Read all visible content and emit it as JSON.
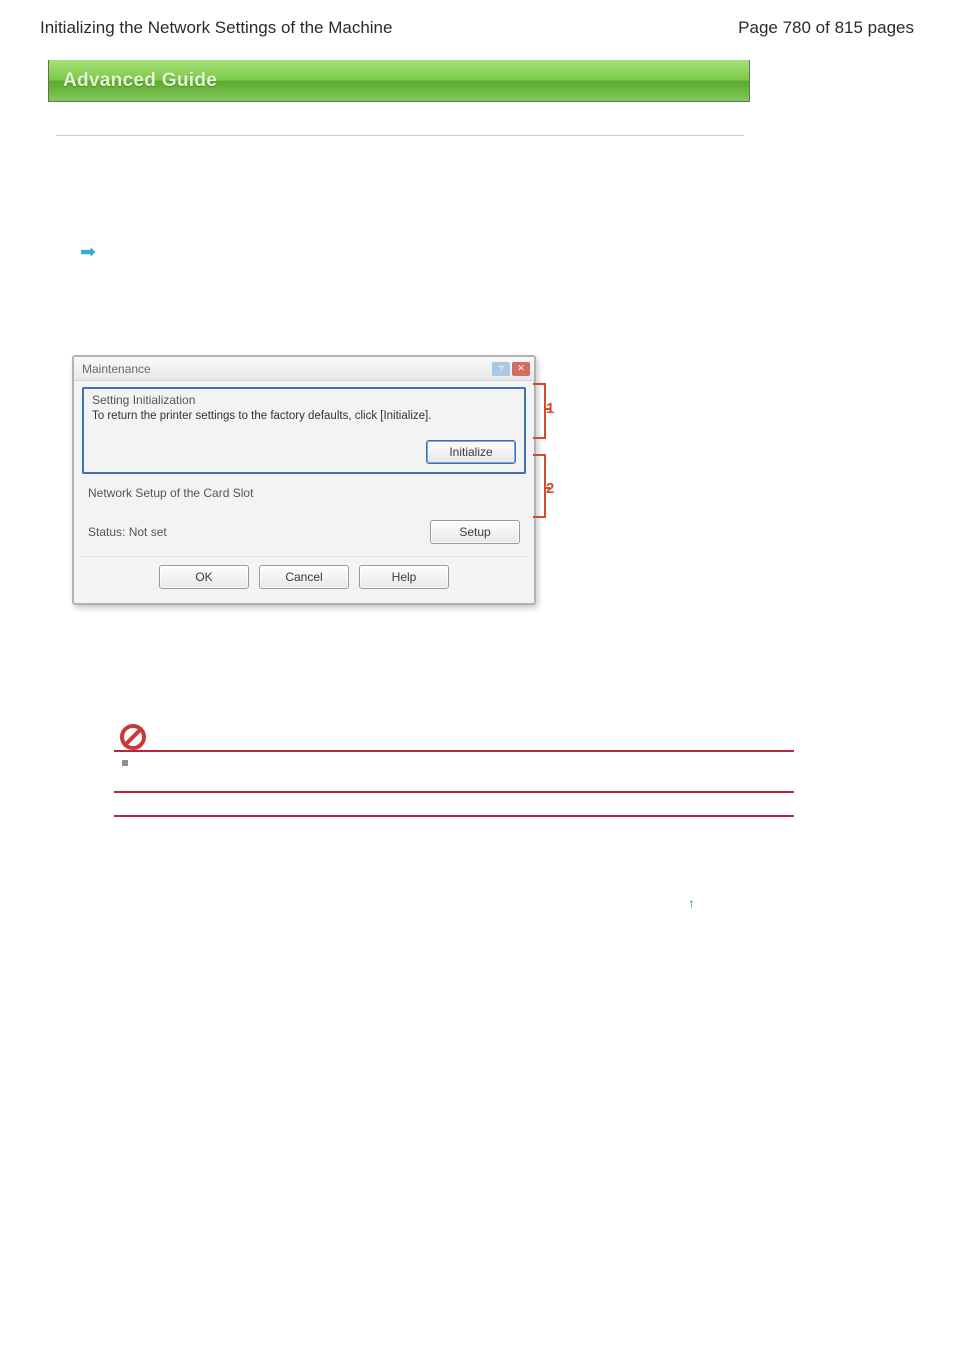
{
  "header": {
    "title": "Initializing the Network Settings of the Machine",
    "page_label": "Page 780 of 815 pages"
  },
  "banner": {
    "text": "Advanced Guide"
  },
  "dialog": {
    "title": "Maintenance",
    "group1_label": "Setting Initialization",
    "group1_desc": "To return the printer settings to the factory defaults, click [Initialize].",
    "initialize_btn": "Initialize",
    "group2_label": "Network Setup of the Card Slot",
    "status_text": "Status: Not set",
    "setup_btn": "Setup",
    "ok_btn": "OK",
    "cancel_btn": "Cancel",
    "help_btn": "Help"
  },
  "callouts": {
    "one": "1",
    "two": "2"
  }
}
